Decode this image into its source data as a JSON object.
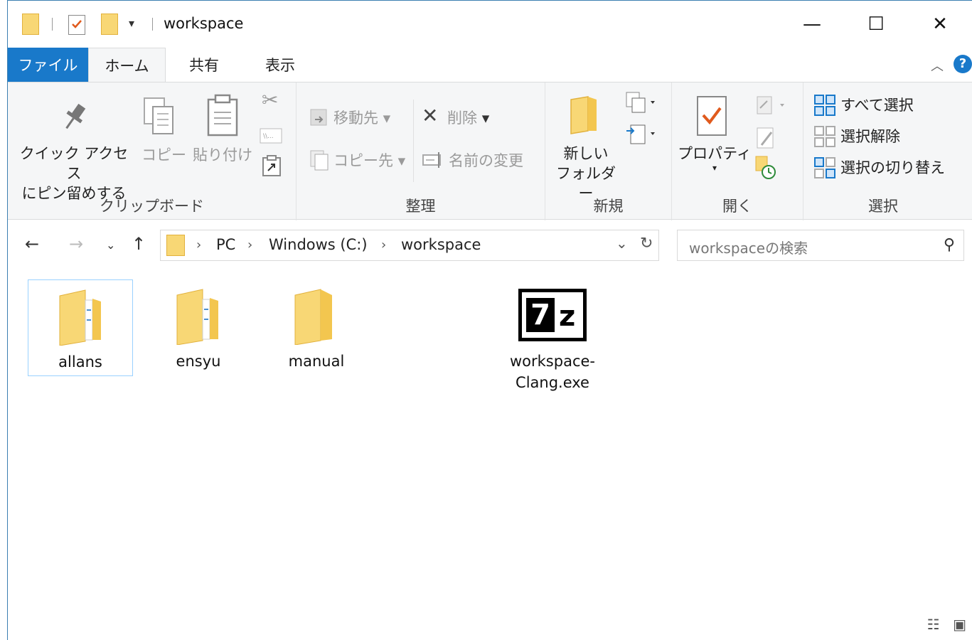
{
  "window": {
    "title": "workspace",
    "minimize": "—",
    "maximize": "☐",
    "close": "✕"
  },
  "tabs": [
    "ファイル",
    "ホーム",
    "共有",
    "表示"
  ],
  "ribbon": {
    "clipboard": {
      "pin_line1": "クイック アクセス",
      "pin_line2": "にピン留めする",
      "copy": "コピー",
      "paste": "貼り付け",
      "label": "クリップボード"
    },
    "organize": {
      "move_to": "移動先",
      "delete": "削除",
      "copy_to": "コピー先",
      "rename": "名前の変更",
      "label": "整理"
    },
    "new": {
      "new_folder_line1": "新しい",
      "new_folder_line2": "フォルダー",
      "label": "新規"
    },
    "open": {
      "properties": "プロパティ",
      "label": "開く"
    },
    "select": {
      "select_all": "すべて選択",
      "select_none": "選択解除",
      "invert": "選択の切り替え",
      "label": "選択"
    }
  },
  "address": {
    "crumbs": [
      "PC",
      "Windows (C:)",
      "workspace"
    ],
    "search_placeholder": "workspaceの検索"
  },
  "files": [
    {
      "name": "allans",
      "type": "folder",
      "selected": true
    },
    {
      "name": "ensyu",
      "type": "folder",
      "selected": false
    },
    {
      "name": "manual",
      "type": "folder",
      "selected": false
    },
    {
      "name_line1": "workspace-",
      "name_line2": "Clang.exe",
      "type": "exe"
    }
  ],
  "exe_icon_text": {
    "seven": "7",
    "z": "z"
  },
  "colors": {
    "accent": "#1979ca",
    "folder": "#f8d775",
    "selection_border": "#99d1ff"
  }
}
